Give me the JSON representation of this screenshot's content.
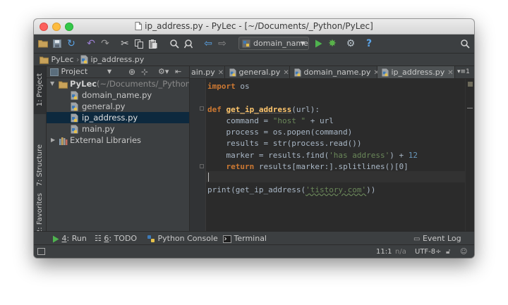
{
  "window": {
    "title": "ip_address.py - PyLec - [~/Documents/_Python/PyLec]"
  },
  "toolbar": {
    "run_config": "domain_name",
    "icons": [
      "open-folder-icon",
      "save-icon",
      "sync-icon",
      "undo-icon",
      "redo-icon",
      "cut-icon",
      "copy-icon",
      "paste-icon",
      "find-icon",
      "replace-icon",
      "back-icon",
      "forward-icon",
      "run-icon",
      "debug-icon",
      "settings-icon",
      "help-icon",
      "search-everywhere-icon"
    ]
  },
  "navbar": {
    "project": "PyLec",
    "file": "ip_address.py"
  },
  "left_strip": {
    "project_tab": "1: Project",
    "structure_tab": "7: Structure",
    "favorites_tab": "2: Favorites"
  },
  "project_panel": {
    "view_mode": "Project",
    "root_name": "PyLec",
    "root_path": "(~/Documents/_Python/PyLec)",
    "files": [
      "domain_name.py",
      "general.py",
      "ip_address.py",
      "main.py"
    ],
    "selected": "ip_address.py",
    "external": "External Libraries"
  },
  "editor_tabs": [
    {
      "label": "ain.py",
      "active": false
    },
    {
      "label": "general.py",
      "active": false
    },
    {
      "label": "domain_name.py",
      "active": false
    },
    {
      "label": "ip_address.py",
      "active": true
    }
  ],
  "tabs_overflow": "1",
  "code": {
    "l1_kw": "import",
    "l1_rest": " os",
    "l3_kw": "def",
    "l3_fn": "get_ip_address",
    "l3_rest": "(url):",
    "l4_a": "    command = ",
    "l4_str": "\"host \"",
    "l4_b": " + url",
    "l5": "    process = os.popen(command)",
    "l6": "    results = str(process.read())",
    "l7_a": "    marker = results.find(",
    "l7_str": "'has address'",
    "l7_b": ") + ",
    "l7_num": "12",
    "l8_kw": "    return",
    "l8_rest": " results[marker:].splitlines()[0]",
    "l10_a": "print(get_ip_address(",
    "l10_str": "'tistory.com'",
    "l10_b": "))"
  },
  "bottom_bar": {
    "run_num": "4",
    "run_label": ": Run",
    "todo_num": "6",
    "todo_label": ": TODO",
    "console": "Python Console",
    "terminal": "Terminal",
    "event_log": "Event Log"
  },
  "status": {
    "position": "11:1",
    "na": "n/a",
    "encoding": "UTF-8÷"
  }
}
